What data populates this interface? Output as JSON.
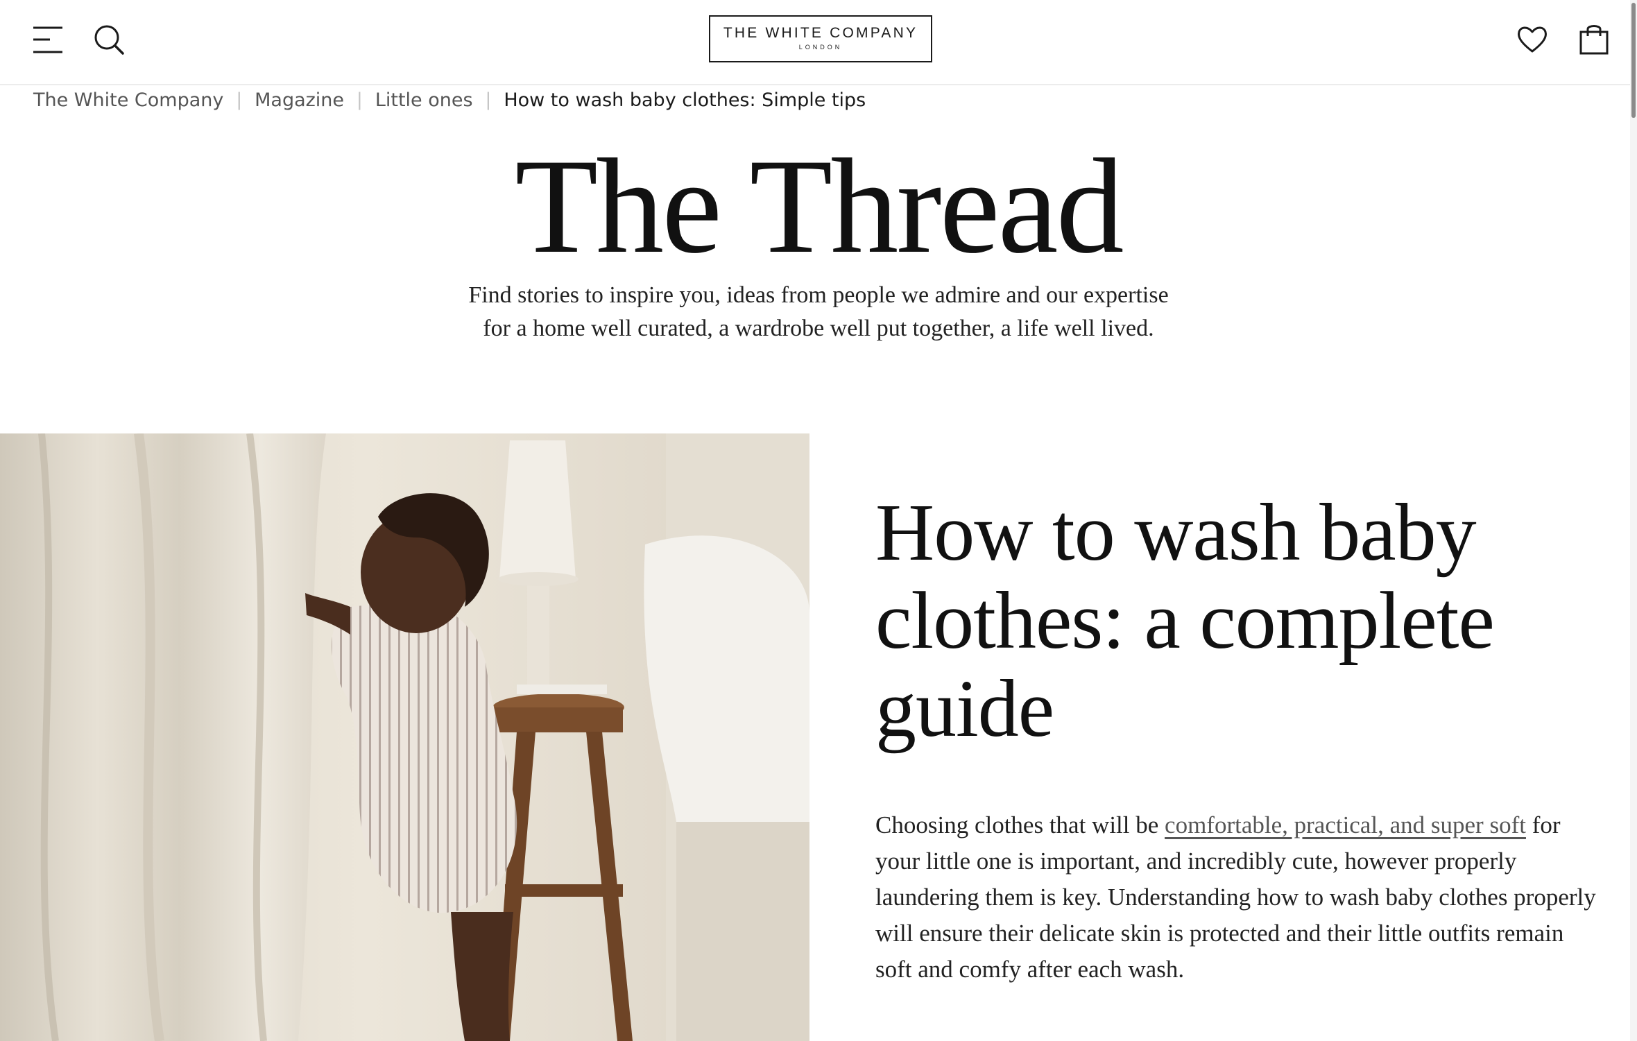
{
  "header": {
    "logo_main": "THE WHITE COMPANY",
    "logo_sub": "LONDON",
    "icons": {
      "menu": "menu-icon",
      "search": "search-icon",
      "wishlist": "heart-icon",
      "bag": "shopping-bag-icon"
    }
  },
  "breadcrumb": {
    "items": [
      {
        "label": "The White Company"
      },
      {
        "label": "Magazine"
      },
      {
        "label": "Little ones"
      },
      {
        "label": "How to wash baby clothes: Simple tips"
      }
    ],
    "separator": "|"
  },
  "magazine": {
    "title": "The Thread",
    "subtitle": "Find stories to inspire you, ideas from people we admire and our expertise for a home well curated, a wardrobe well put together, a life well lived."
  },
  "article": {
    "title": "How to wash baby clothes: a complete guide",
    "intro_before": "Choosing clothes that will be ",
    "intro_link": "comfortable, practical, and super soft",
    "intro_after": " for your little one is important, and incredibly cute, however properly laundering them is key. Understanding how to wash baby clothes properly will ensure their delicate skin is protected and their little outfits remain soft and comfy after each wash."
  },
  "colors": {
    "text": "#1a1a1a",
    "muted": "#555555",
    "border": "#ececec",
    "background": "#ffffff"
  }
}
